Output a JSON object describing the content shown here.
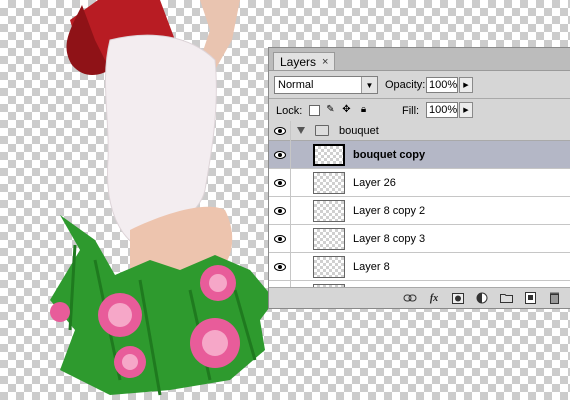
{
  "panel": {
    "tab_label": "Layers",
    "tab_close": "×",
    "blend_mode": "Normal",
    "opacity_label": "Opacity:",
    "opacity_value": "100%",
    "lock_label": "Lock:",
    "fill_label": "Fill:",
    "fill_value": "100%"
  },
  "group": {
    "name": "bouquet",
    "expanded": true
  },
  "layers": [
    {
      "name": "bouquet copy",
      "selected": true,
      "visible": true
    },
    {
      "name": "Layer 26",
      "selected": false,
      "visible": true
    },
    {
      "name": "Layer 8 copy 2",
      "selected": false,
      "visible": true
    },
    {
      "name": "Layer 8 copy 3",
      "selected": false,
      "visible": true
    },
    {
      "name": "Layer 8",
      "selected": false,
      "visible": true
    }
  ],
  "bottom_bar": {
    "fx_label": "fx",
    "icons": [
      "link-layers-icon",
      "fx-icon",
      "add-mask-icon",
      "adjustment-layer-icon",
      "new-group-icon",
      "new-layer-icon",
      "delete-layer-icon"
    ]
  },
  "colors": {
    "panel_bg": "#d6d6d6",
    "selected_row": "#b4b7c6",
    "rose_pink": "#e85c9a",
    "greenery": "#2e9a2e",
    "hair": "#b81c23"
  }
}
